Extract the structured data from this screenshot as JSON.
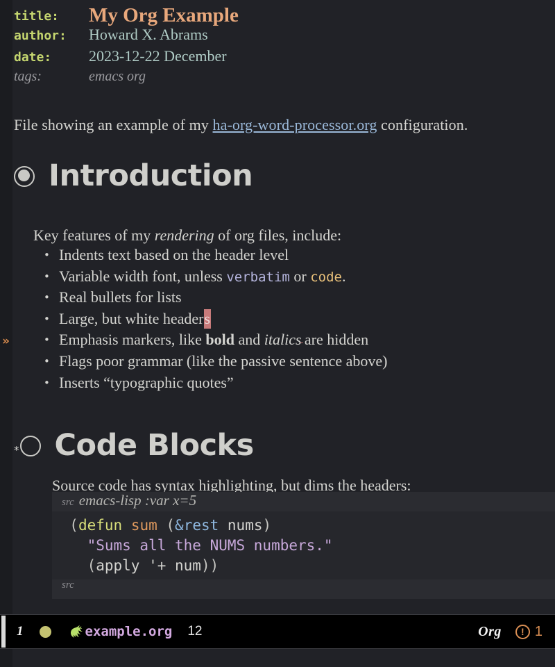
{
  "document": {
    "keywords": [
      {
        "key": "title:",
        "value": "My Org Example"
      },
      {
        "key": "author:",
        "value": "Howard X. Abrams"
      },
      {
        "key": "date:",
        "value": "2023-12-22 December"
      },
      {
        "key": "tags:",
        "value": "emacs org"
      }
    ],
    "intro": {
      "before": "File showing an example of my ",
      "link": "ha-org-word-processor.org",
      "after": " configuration."
    },
    "sections": [
      {
        "bullet": "filled-ring",
        "leading_star": "",
        "heading": "Introduction",
        "lead_in": {
          "before": "Key features of my ",
          "italic": "rendering",
          "after": " of org files, include:"
        },
        "list": [
          {
            "bullet": "•",
            "parts": [
              {
                "t": "plain",
                "s": "Indents text based on the header level"
              }
            ]
          },
          {
            "bullet": "•",
            "parts": [
              {
                "t": "plain",
                "s": "Variable width font, unless "
              },
              {
                "t": "verbatim",
                "s": "verbatim"
              },
              {
                "t": "plain",
                "s": " or "
              },
              {
                "t": "code",
                "s": "code"
              },
              {
                "t": "plain",
                "s": "."
              }
            ]
          },
          {
            "bullet": "•",
            "parts": [
              {
                "t": "plain",
                "s": "Real bullets for lists"
              }
            ]
          },
          {
            "bullet": "•",
            "parts": [
              {
                "t": "plain",
                "s": "Large, but white header"
              },
              {
                "t": "highlight",
                "s": "s"
              }
            ]
          },
          {
            "bullet": "•",
            "parts": [
              {
                "t": "plain",
                "s": "Emphasis markers, like "
              },
              {
                "t": "bold",
                "s": "bold"
              },
              {
                "t": "plain",
                "s": " and "
              },
              {
                "t": "italic",
                "s": "italics"
              },
              {
                "t": "caret",
                "s": "ˇ"
              },
              {
                "t": "plain",
                "s": "are hidden"
              }
            ]
          },
          {
            "bullet": "•",
            "parts": [
              {
                "t": "plain",
                "s": "Flags poor grammar (like the passive sentence above)"
              }
            ]
          },
          {
            "bullet": "•",
            "parts": [
              {
                "t": "plain",
                "s": "Inserts “typographic quotes”"
              }
            ]
          }
        ]
      },
      {
        "bullet": "hollow-ring",
        "leading_star": "*",
        "heading": "Code Blocks",
        "lead_in_text": "Source code has syntax highlighting, but dims the headers:"
      }
    ],
    "src_block": {
      "begin_keyword": "src",
      "header_args": "emacs-lisp :var x=5",
      "end_keyword": "src",
      "lines": [
        [
          {
            "t": "paren",
            "s": "  ("
          },
          {
            "t": "defun",
            "s": "defun"
          },
          {
            "t": "plain",
            "s": " "
          },
          {
            "t": "fname",
            "s": "sum"
          },
          {
            "t": "paren",
            "s": " ("
          },
          {
            "t": "amp",
            "s": "&rest"
          },
          {
            "t": "var",
            "s": " nums"
          },
          {
            "t": "paren",
            "s": ")"
          }
        ],
        [
          {
            "t": "string",
            "s": "    \"Sums all the NUMS numbers.\""
          }
        ],
        [
          {
            "t": "paren",
            "s": "    ("
          },
          {
            "t": "var",
            "s": "apply "
          },
          {
            "t": "quote",
            "s": "'+"
          },
          {
            "t": "var",
            "s": " num"
          },
          {
            "t": "paren",
            "s": "))"
          }
        ]
      ]
    },
    "fringe_marker": "»"
  },
  "modeline": {
    "window_number": "1",
    "status_dot": "saved-indicator",
    "gnu_icon": "gnu-head-icon",
    "buffer_name": "example.org",
    "column": "12",
    "major_mode": "Org",
    "warning_icon": "!",
    "warning_count": "1"
  }
}
